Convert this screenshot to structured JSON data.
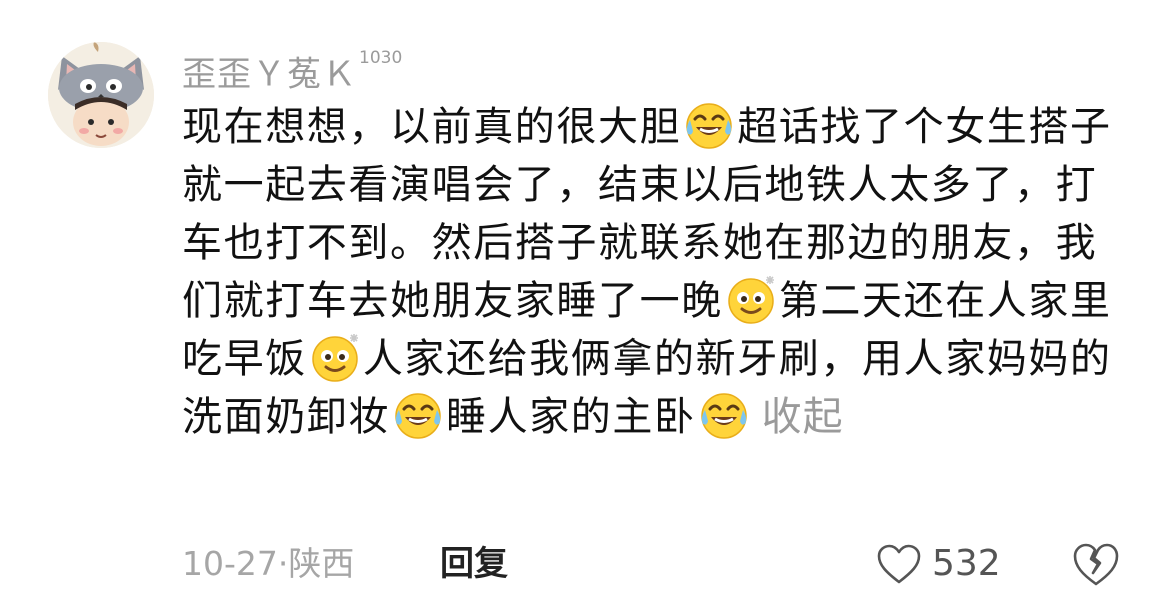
{
  "comment": {
    "username": "歪歪Ｙ菟Ｋ",
    "level_badge": "1030",
    "segments": [
      {
        "type": "text",
        "value": "现在想想，以前真的很大胆"
      },
      {
        "type": "emoji",
        "icon": "laughing-tears-emoji"
      },
      {
        "type": "text",
        "value": "超话找了个女生搭子就一起去看演唱会了，结束以后地铁人太多了，打车也打不到。然后搭子就联系她在那边的朋友，我们就打车去她朋友家睡了一晚"
      },
      {
        "type": "emoji",
        "icon": "sparkle-grin-emoji"
      },
      {
        "type": "text",
        "value": "第二天还在人家里吃早饭"
      },
      {
        "type": "emoji",
        "icon": "sparkle-grin-emoji"
      },
      {
        "type": "text",
        "value": "人家还给我俩拿的新牙刷，用人家妈妈的洗面奶卸妆"
      },
      {
        "type": "emoji",
        "icon": "laughing-tears-emoji"
      },
      {
        "type": "text",
        "value": "睡人家的主卧"
      },
      {
        "type": "emoji",
        "icon": "laughing-tears-emoji"
      }
    ],
    "collapse_label": "收起",
    "date": "10-27",
    "separator": "·",
    "location": "陕西",
    "reply_label": "回复",
    "like_count": "532",
    "icons": {
      "like": "heart-outline-icon",
      "dislike": "broken-heart-icon"
    },
    "colors": {
      "text": "#111111",
      "muted": "#9b9b9b",
      "emoji_face": "#ffd43a"
    }
  }
}
